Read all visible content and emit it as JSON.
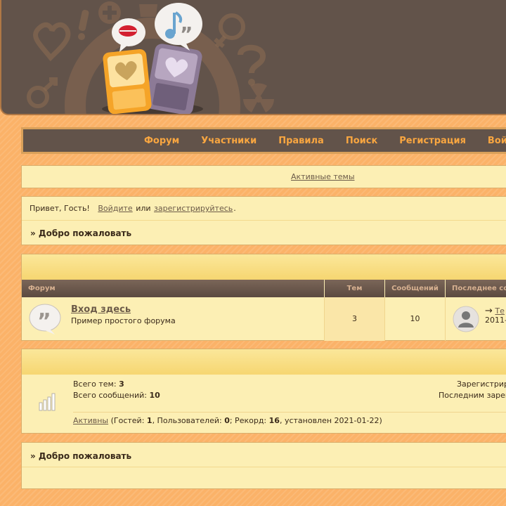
{
  "nav": {
    "items": [
      "Форум",
      "Участники",
      "Правила",
      "Поиск",
      "Регистрация",
      "Войти"
    ]
  },
  "active_topics": {
    "label": "Активные темы"
  },
  "welcome": {
    "greeting": "Привет, Гость!",
    "login_link": "Войдите",
    "or_text": "или",
    "register_link": "зарегистрируйтесь",
    "period": ".",
    "title": "» Добро пожаловать"
  },
  "forums": {
    "columns": [
      "Форум",
      "Тем",
      "Сообщений",
      "Последнее со"
    ],
    "rows": [
      {
        "title": "Вход здесь",
        "description": "Пример простого форума",
        "topics": "3",
        "posts": "10",
        "last_arrow": "→",
        "last_link": "Те",
        "last_date": "2011-"
      }
    ]
  },
  "stats": {
    "total_topics_label": "Всего тем:",
    "total_topics": "3",
    "total_posts_label": "Всего сообщений:",
    "total_posts": "10",
    "registered_label": "Зарегистрир",
    "last_registered_label": "Последним зарег",
    "active_link": "Активны",
    "guests_label": "(Гостей:",
    "guests": "1",
    "users_label": ", Пользователей:",
    "users": "0",
    "record_label": "; Рекорд:",
    "record": "16",
    "record_date_label": ", установлен 2021-01-22)"
  },
  "welcome_footer": {
    "title": "» Добро пожаловать"
  },
  "colors": {
    "page_bg": "#fbb268",
    "header_bg": "#62534a",
    "nav_text": "#f9a640",
    "panel_bg": "#fcefb4",
    "table_head": "#6b5a4c"
  }
}
